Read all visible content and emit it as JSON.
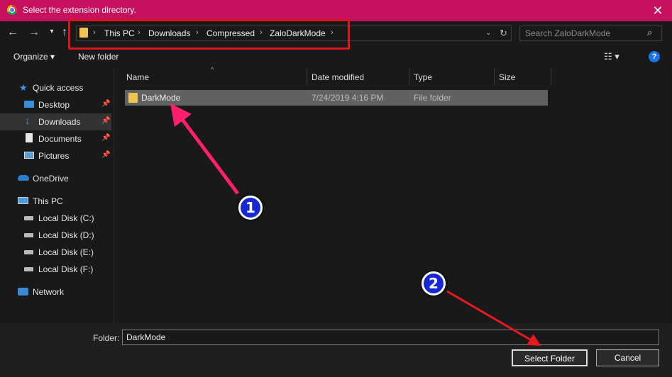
{
  "window": {
    "title": "Select the extension directory.",
    "close_glyph": "✕"
  },
  "breadcrumb": {
    "items": [
      "This PC",
      "Downloads",
      "Compressed",
      "ZaloDarkMode"
    ]
  },
  "search": {
    "placeholder": "Search ZaloDarkMode"
  },
  "toolbar": {
    "organize_label": "Organize ▾",
    "new_folder_label": "New folder",
    "help_label": "?"
  },
  "sidebar": {
    "items": [
      {
        "label": "Quick access",
        "icon": "star-icon"
      },
      {
        "label": "Desktop",
        "icon": "desktop-icon",
        "pinned": true
      },
      {
        "label": "Downloads",
        "icon": "download-icon",
        "pinned": true,
        "selected": true
      },
      {
        "label": "Documents",
        "icon": "document-icon",
        "pinned": true
      },
      {
        "label": "Pictures",
        "icon": "picture-icon",
        "pinned": true
      },
      {
        "label": "OneDrive",
        "icon": "cloud-icon"
      },
      {
        "label": "This PC",
        "icon": "computer-icon"
      },
      {
        "label": "Local Disk (C:)",
        "icon": "drive-icon"
      },
      {
        "label": "Local Disk (D:)",
        "icon": "drive-icon"
      },
      {
        "label": "Local Disk (E:)",
        "icon": "drive-icon"
      },
      {
        "label": "Local Disk (F:)",
        "icon": "drive-icon"
      },
      {
        "label": "Network",
        "icon": "network-icon"
      }
    ]
  },
  "columns": {
    "name": "Name",
    "date": "Date modified",
    "type": "Type",
    "size": "Size"
  },
  "files": [
    {
      "name": "DarkMode",
      "date": "7/24/2019 4:16 PM",
      "type": "File folder",
      "size": ""
    }
  ],
  "footer": {
    "folder_label": "Folder:",
    "folder_value": "DarkMode",
    "select_label": "Select Folder",
    "cancel_label": "Cancel"
  },
  "annotations": {
    "badge_1": "1",
    "badge_2": "2"
  },
  "colors": {
    "titlebar": "#c8115e",
    "highlight_box": "#e1141e",
    "arrow_1": "#ff1f6e",
    "arrow_2": "#e81820",
    "badge": "#1627d4"
  }
}
